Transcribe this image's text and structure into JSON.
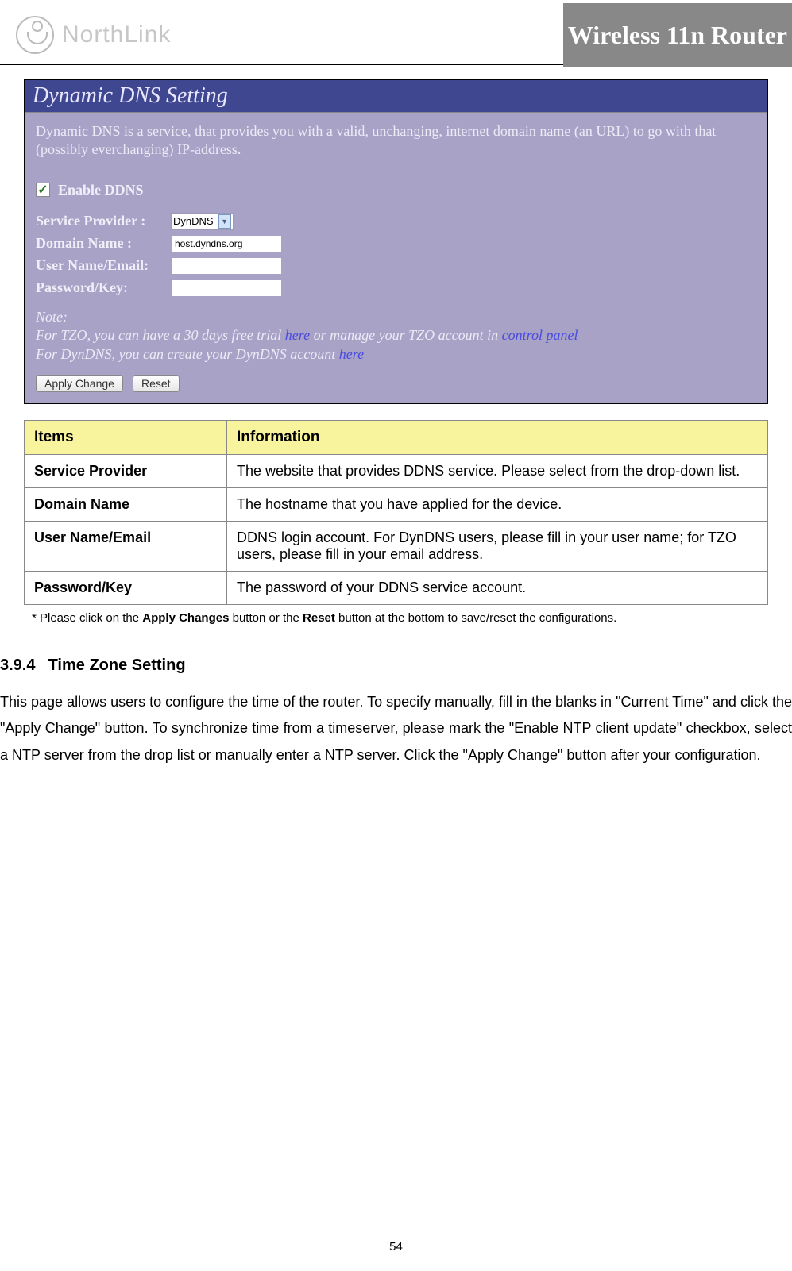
{
  "header": {
    "logo_text": "NorthLink",
    "brand": "Wireless 11n Router"
  },
  "screenshot": {
    "title": "Dynamic DNS  Setting",
    "description": "Dynamic DNS is a service, that provides you with a valid, unchanging, internet domain name (an URL) to go with that (possibly everchanging) IP-address.",
    "enable_label": "Enable DDNS",
    "enable_checked": "✓",
    "fields": {
      "service_provider_label": "Service Provider :",
      "service_provider_value": "DynDNS",
      "domain_name_label": "Domain Name :",
      "domain_name_value": "host.dyndns.org",
      "user_label": "User Name/Email:",
      "user_value": "",
      "password_label": "Password/Key:",
      "password_value": ""
    },
    "note_label": "Note:",
    "note_line1_a": "For TZO, you can have a 30 days free trial ",
    "note_line1_link1": "here",
    "note_line1_b": " or manage your TZO account in ",
    "note_line1_link2": "control panel",
    "note_line2_a": "For DynDNS, you can create your DynDNS account ",
    "note_line2_link": "here",
    "buttons": {
      "apply": "Apply Change",
      "reset": "Reset"
    }
  },
  "table": {
    "header": {
      "items": "Items",
      "info": "Information"
    },
    "rows": [
      {
        "label": "Service Provider",
        "value": "The website that provides DDNS service. Please select from the drop-down list."
      },
      {
        "label": "Domain Name",
        "value": "The hostname that you have applied for the device."
      },
      {
        "label": "User Name/Email",
        "value": "DDNS login account. For DynDNS users, please fill in your user name; for TZO users, please fill in your email address."
      },
      {
        "label": "Password/Key",
        "value": "The password of your DDNS service account."
      }
    ]
  },
  "footnote": {
    "prefix": "* Please click on the ",
    "b1": "Apply Changes",
    "mid": " button or the ",
    "b2": "Reset",
    "suffix": " button at the bottom to save/reset the configurations."
  },
  "section": {
    "number": "3.9.4",
    "title": "Time Zone Setting",
    "paragraph": "This page allows users to configure the time of the router. To specify manually, fill in the blanks in \"Current Time\" and click the \"Apply Change\" button. To synchronize time from a timeserver, please mark the \"Enable NTP client update\" checkbox, select a NTP server from the drop list or manually enter a NTP server. Click the \"Apply Change\" button after your configuration."
  },
  "page_number": "54"
}
